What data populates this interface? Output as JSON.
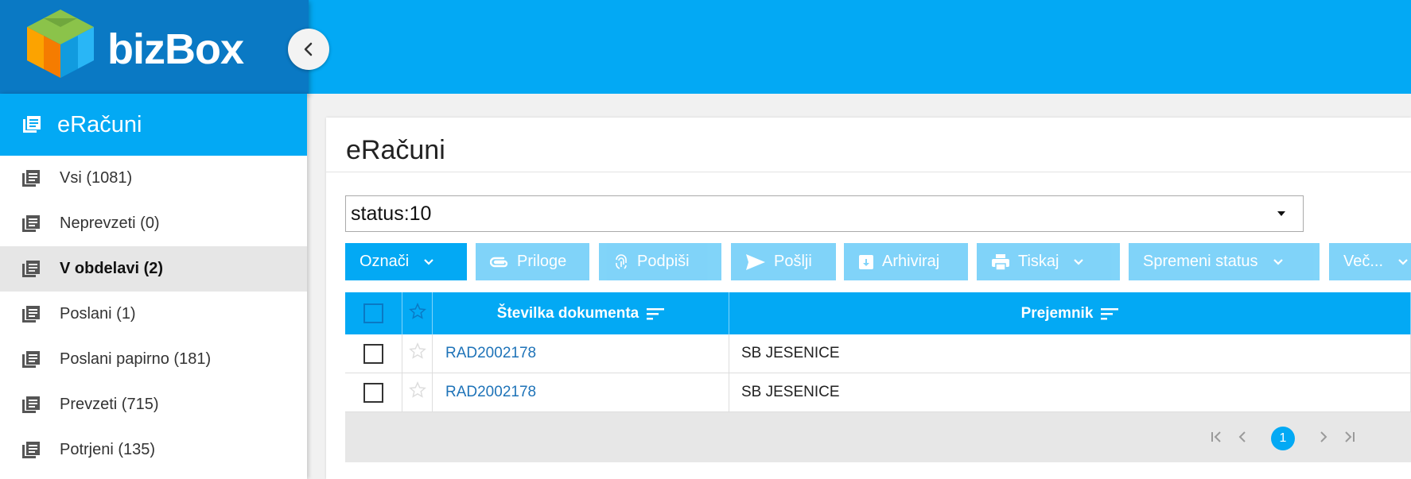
{
  "app": {
    "name": "bizBox",
    "brand_colors": {
      "primary": "#03a9f4",
      "dark": "#0a79c4"
    },
    "logo_icon": "cube-logo-icon",
    "collapse_icon": "chevron-left-icon"
  },
  "sidebar": {
    "header": {
      "label": "eRačuni",
      "icon": "list-icon"
    },
    "items": [
      {
        "label": "Vsi (1081)",
        "icon": "list-icon",
        "active": false
      },
      {
        "label": "Neprevzeti (0)",
        "icon": "list-icon",
        "active": false
      },
      {
        "label": "V obdelavi (2)",
        "icon": "list-icon",
        "active": true
      },
      {
        "label": "Poslani (1)",
        "icon": "list-icon",
        "active": false
      },
      {
        "label": "Poslani papirno (181)",
        "icon": "list-icon",
        "active": false
      },
      {
        "label": "Prevzeti (715)",
        "icon": "list-icon",
        "active": false
      },
      {
        "label": "Potrjeni (135)",
        "icon": "list-icon",
        "active": false
      }
    ]
  },
  "main": {
    "title": "eRačuni",
    "filter": {
      "value": "status:10"
    },
    "toolbar": {
      "oznaci": "Označi",
      "priloge": "Priloge",
      "podpisi": "Podpiši",
      "poslji": "Pošlji",
      "arhiviraj": "Arhiviraj",
      "tiskaj": "Tiskaj",
      "spremeni_status": "Spremeni status",
      "vec": "Več..."
    },
    "grid": {
      "columns": {
        "doc": "Številka dokumenta",
        "recipient": "Prejemnik"
      },
      "rows": [
        {
          "doc": "RAD2002178",
          "recipient": "SB JESENICE",
          "checked": false,
          "starred": false
        },
        {
          "doc": "RAD2002178",
          "recipient": "SB JESENICE",
          "checked": false,
          "starred": false
        }
      ],
      "pager": {
        "current_page": "1"
      }
    }
  }
}
